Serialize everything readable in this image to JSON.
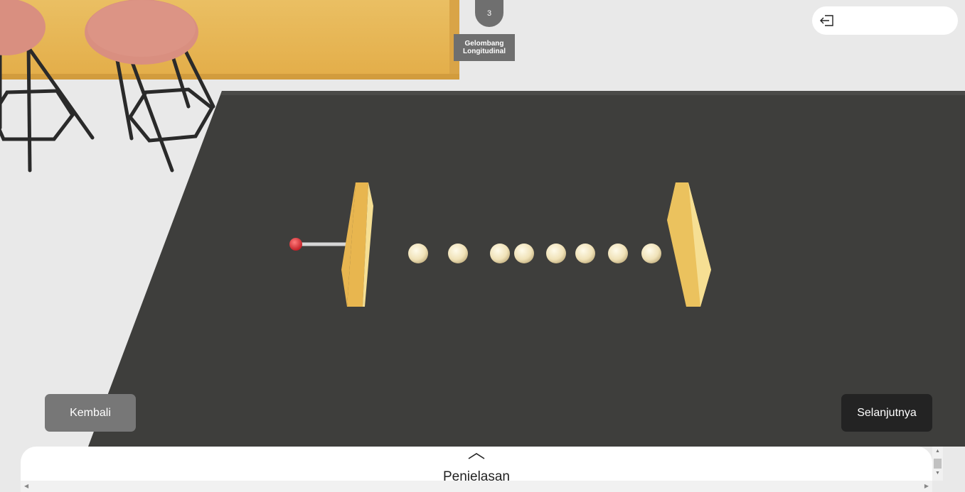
{
  "step": {
    "number": "3",
    "title_line1": "Gelombang",
    "title_line2": "Longitudinal"
  },
  "toolbar": {
    "exit_icon": "exit-icon"
  },
  "navigation": {
    "back_label": "Kembali",
    "next_label": "Selanjutnya"
  },
  "panel": {
    "title": "Penjelasan",
    "toggle_icon": "chevron-up-icon"
  },
  "colors": {
    "floor": "#3e3e3c",
    "wall": "#e9e9e9",
    "table": "#e8b95a",
    "stool_seat": "#d98f80",
    "plate": "#f2d26a",
    "ball": "#f3e6c2",
    "handle": "#d9363a",
    "back_button": "#777777",
    "next_button": "#232323"
  }
}
